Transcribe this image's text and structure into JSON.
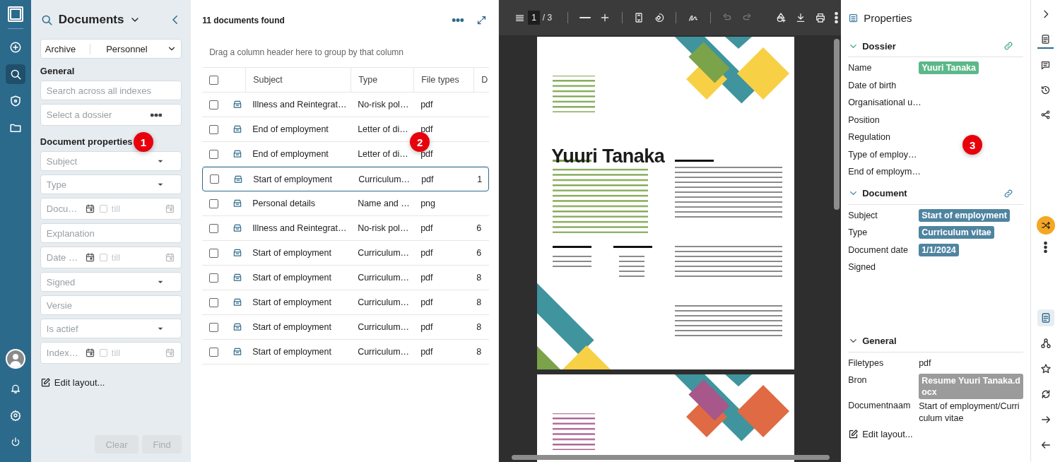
{
  "nav_rail": {
    "items": [
      {
        "kind": "add",
        "selected": false
      },
      {
        "kind": "search",
        "selected": true
      },
      {
        "kind": "shield",
        "selected": false
      },
      {
        "kind": "folder",
        "selected": false
      }
    ],
    "bottom": [
      {
        "kind": "avatar"
      },
      {
        "kind": "bell"
      },
      {
        "kind": "settings"
      },
      {
        "kind": "power"
      }
    ]
  },
  "search_panel": {
    "title": "Documents",
    "callout": "1",
    "archive": {
      "label": "Archive",
      "value": "Personnel"
    },
    "general_heading": "General",
    "general_fields": [
      {
        "kind": "text",
        "placeholder": "Search across all indexes"
      },
      {
        "kind": "lookup",
        "placeholder": "Select a dossier"
      }
    ],
    "properties_heading": "Document properties",
    "property_fields": [
      {
        "kind": "select",
        "placeholder": "Subject"
      },
      {
        "kind": "select",
        "placeholder": "Type"
      },
      {
        "kind": "daterange",
        "placeholder": "Docu…",
        "till": "till",
        "checked": false
      },
      {
        "kind": "text",
        "placeholder": "Explanation"
      },
      {
        "kind": "daterange",
        "placeholder": "Date …",
        "till": "till",
        "checked": false
      },
      {
        "kind": "select",
        "placeholder": "Signed"
      },
      {
        "kind": "text",
        "placeholder": "Versie"
      },
      {
        "kind": "select",
        "placeholder": "Is actief"
      },
      {
        "kind": "daterange",
        "placeholder": "Index…",
        "till": "till",
        "checked": false
      }
    ],
    "edit_layout": "Edit layout...",
    "buttons": [
      {
        "label": "Clear",
        "disabled": true
      },
      {
        "label": "Find",
        "disabled": true
      }
    ]
  },
  "results": {
    "count": "11 documents found",
    "callout": "2",
    "group_hint": "Drag a column header here to group by that column",
    "columns": [
      "Subject",
      "Type",
      "File types",
      "D"
    ],
    "all_checked": false,
    "rows": [
      {
        "subject": "Illness and Reintegrat…",
        "type": "No-risk pol…",
        "file_type": "pdf",
        "column_4": "",
        "checked": false,
        "selected": false
      },
      {
        "subject": "End of employment",
        "type": "Letter of di…",
        "file_type": "pdf",
        "column_4": "",
        "checked": false,
        "selected": false
      },
      {
        "subject": "End of employment",
        "type": "Letter of di…",
        "file_type": "pdf",
        "column_4": "",
        "checked": false,
        "selected": false
      },
      {
        "subject": "Start of employment",
        "type": "Curriculum…",
        "file_type": "pdf",
        "column_4": "1",
        "checked": false,
        "selected": true
      },
      {
        "subject": "Personal details",
        "type": "Name and …",
        "file_type": "png",
        "column_4": "",
        "checked": false,
        "selected": false
      },
      {
        "subject": "Illness and Reintegrat…",
        "type": "No-risk pol…",
        "file_type": "pdf",
        "column_4": "6",
        "checked": false,
        "selected": false
      },
      {
        "subject": "Start of employment",
        "type": "Curriculum…",
        "file_type": "pdf",
        "column_4": "6",
        "checked": false,
        "selected": false
      },
      {
        "subject": "Start of employment",
        "type": "Curriculum…",
        "file_type": "pdf",
        "column_4": "8",
        "checked": false,
        "selected": false
      },
      {
        "subject": "Start of employment",
        "type": "Curriculum…",
        "file_type": "pdf",
        "column_4": "8",
        "checked": false,
        "selected": false
      },
      {
        "subject": "Start of employment",
        "type": "Curriculum…",
        "file_type": "pdf",
        "column_4": "8",
        "checked": false,
        "selected": false
      },
      {
        "subject": "Start of employment",
        "type": "Curriculum…",
        "file_type": "pdf",
        "column_4": "8",
        "checked": false,
        "selected": false
      }
    ]
  },
  "viewer": {
    "page": "1",
    "page_count": "/ 3",
    "document_heading": "Yuuri Tanaka",
    "tools": [
      {
        "kind": "zoom-out",
        "disabled": false
      },
      {
        "kind": "zoom-in",
        "disabled": false
      },
      {
        "kind": "fit",
        "disabled": false
      },
      {
        "kind": "rotate",
        "disabled": false
      },
      {
        "kind": "draw",
        "disabled": false
      },
      {
        "kind": "undo",
        "disabled": true
      },
      {
        "kind": "redo",
        "disabled": true
      },
      {
        "kind": "shapes",
        "disabled": false
      },
      {
        "kind": "download",
        "disabled": false
      },
      {
        "kind": "print",
        "disabled": false
      },
      {
        "kind": "more",
        "disabled": false
      }
    ]
  },
  "properties": {
    "title": "Properties",
    "callout": "3",
    "edit_layout": "Edit layout...",
    "sections": [
      {
        "title": "Dossier",
        "color": "#3aa57a",
        "linked": true,
        "fields": [
          {
            "label": "Name",
            "value": "Yuuri Tanaka",
            "kind": "tag",
            "color": "#5cb88a"
          },
          {
            "label": "Date of birth"
          },
          {
            "label": "Organisational u…"
          },
          {
            "label": "Position"
          },
          {
            "label": "Regulation"
          },
          {
            "label": "Type of employ…"
          },
          {
            "label": "End of employm…"
          }
        ]
      },
      {
        "title": "Document",
        "color": "#3f7fa6",
        "linked": true,
        "fields": [
          {
            "label": "Subject",
            "value": "Start of employment",
            "kind": "tag",
            "color": "#4f84a0"
          },
          {
            "label": "Type",
            "value": "Curriculum vitae",
            "kind": "tag",
            "color": "#4f84a0"
          },
          {
            "label": "Document date",
            "value": "1/1/2024",
            "kind": "tag",
            "color": "#4f84a0"
          },
          {
            "label": "Signed"
          }
        ]
      },
      {
        "title": "General",
        "color": "#444444",
        "linked": false,
        "fields": [
          {
            "label": "Filetypes",
            "value": "pdf",
            "kind": "text"
          },
          {
            "label": "Bron",
            "value": "Resume Yuuri Tanaka.docx",
            "kind": "tag",
            "color": "#9b9b9b"
          },
          {
            "label": "Documentnaam",
            "value": "Start of employment/Curriculum vitae",
            "kind": "text"
          }
        ]
      }
    ]
  },
  "side_rail": {
    "top": [
      {
        "kind": "document",
        "selected": true
      },
      {
        "kind": "comment",
        "selected": false
      },
      {
        "kind": "history",
        "selected": false
      },
      {
        "kind": "share",
        "selected": false
      }
    ],
    "bottom": [
      {
        "kind": "document",
        "selected": true
      },
      {
        "kind": "hierarchy",
        "selected": false
      },
      {
        "kind": "star",
        "selected": false
      },
      {
        "kind": "sync",
        "selected": false
      },
      {
        "kind": "arrow-right",
        "selected": false
      },
      {
        "kind": "arrow-left",
        "selected": false
      }
    ]
  }
}
